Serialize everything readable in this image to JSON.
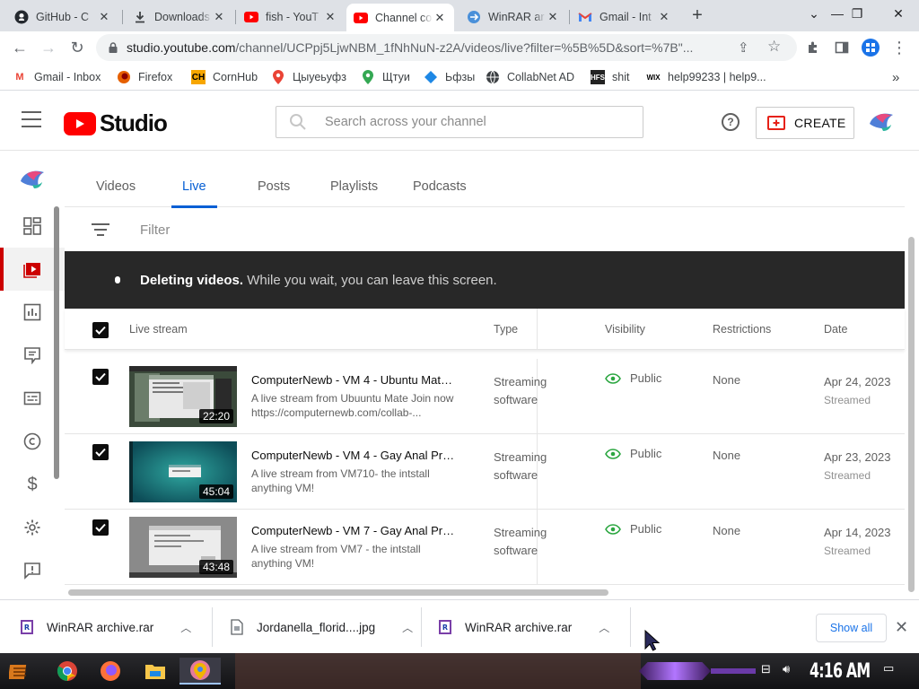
{
  "browser": {
    "tabs": [
      {
        "title": "GitHub - C",
        "icon": "github-icon"
      },
      {
        "title": "Downloads",
        "icon": "download-icon"
      },
      {
        "title": "fish - YouT",
        "icon": "youtube-icon"
      },
      {
        "title": "Channel co",
        "icon": "youtube-studio-icon",
        "active": true
      },
      {
        "title": "WinRAR ar",
        "icon": "winrar-web-icon"
      },
      {
        "title": "Gmail - Int",
        "icon": "gmail-icon"
      }
    ],
    "url_host": "studio.youtube.com",
    "url_path": "/channel/UCPpj5LjwNBM_1fNhNuN-z2A/videos/live?filter=%5B%5D&sort=%7B\"...",
    "bookmarks": [
      {
        "label": "Gmail - Inbox",
        "icon": "gmail-icon"
      },
      {
        "label": "Firefox",
        "icon": "firefox-icon"
      },
      {
        "label": "CornHub",
        "icon": "ch-icon"
      },
      {
        "label": "Цыуеьуфз",
        "icon": "map-pin-icon"
      },
      {
        "label": "Щтуи",
        "icon": "map-pin-icon"
      },
      {
        "label": "Ьфзы",
        "icon": "diamond-icon"
      },
      {
        "label": "CollabNet AD",
        "icon": "globe-icon"
      },
      {
        "label": "shit",
        "icon": "hfs-icon"
      },
      {
        "label": "help99233 | help9...",
        "icon": "wix-icon"
      }
    ],
    "more_bookmarks": "»"
  },
  "studio": {
    "logo_text": "Studio",
    "search_placeholder": "Search across your channel",
    "create_label": "CREATE",
    "help_label": "?",
    "tabs": [
      "Videos",
      "Live",
      "Posts",
      "Playlists",
      "Podcasts"
    ],
    "active_tab": "Live",
    "filter_placeholder": "Filter",
    "banner": {
      "bold": "Deleting videos.",
      "rest": " While you wait, you can leave this screen."
    },
    "columns": [
      "Live stream",
      "Type",
      "Visibility",
      "Restrictions",
      "Date"
    ],
    "rows": [
      {
        "title": "ComputerNewb - VM 4 - Ubuntu Mate ...",
        "desc": "A live stream from Ubuuntu Mate Join now https://computernewb.com/collab-...",
        "duration": "22:20",
        "type_line1": "Streaming",
        "type_line2": "software",
        "visibility": "Public",
        "restrictions": "None",
        "date": "Apr 24, 2023",
        "date_sub": "Streamed",
        "checked": true
      },
      {
        "title": "ComputerNewb - VM 4 - Gay Anal Prol...",
        "desc": "A live stream from VM710- the intstall anything VM!",
        "duration": "45:04",
        "type_line1": "Streaming",
        "type_line2": "software",
        "visibility": "Public",
        "restrictions": "None",
        "date": "Apr 23, 2023",
        "date_sub": "Streamed",
        "checked": true
      },
      {
        "title": "ComputerNewb - VM 7 - Gay Anal Prol...",
        "desc": "A live stream from VM7 - the intstall anything VM!",
        "duration": "43:48",
        "type_line1": "Streaming",
        "type_line2": "software",
        "visibility": "Public",
        "restrictions": "None",
        "date": "Apr 14, 2023",
        "date_sub": "Streamed",
        "checked": true
      }
    ]
  },
  "downloads": [
    {
      "name": "WinRAR archive.rar",
      "icon": "rar-file-icon"
    },
    {
      "name": "Jordanella_florid....jpg",
      "icon": "image-file-icon"
    },
    {
      "name": "WinRAR archive.rar",
      "icon": "rar-file-icon"
    }
  ],
  "downloads_show_all": "Show all",
  "taskbar": {
    "clock": "4:16 AM"
  },
  "colors": {
    "accent_blue": "#065fd4",
    "youtube_red": "#ff0000",
    "active_nav_red": "#cc0000",
    "banner_bg": "#282828"
  }
}
